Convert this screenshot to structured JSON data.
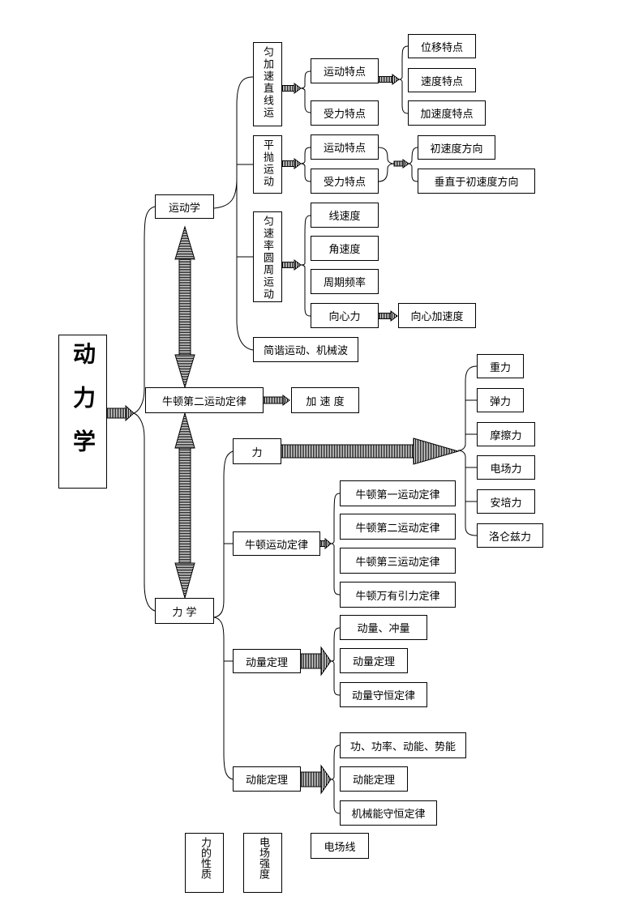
{
  "root": "动力学",
  "level1": {
    "kinematics": "运动学",
    "newton2": "牛顿第二运动定律",
    "acceleration": "加 速 度",
    "mechanics": "力 学"
  },
  "kinematics": {
    "uniform_accel": "匀加速直线运",
    "projectile": "平抛运动",
    "circular": "匀速率圆周运动",
    "shm": "简谐运动、机械波",
    "ua_items": [
      "运动特点",
      "受力特点"
    ],
    "ua_sub": [
      "位移特点",
      "速度特点",
      "加速度特点"
    ],
    "pr_items": [
      "运动特点",
      "受力特点"
    ],
    "pr_sub": [
      "初速度方向",
      "垂直于初速度方向"
    ],
    "circ_items": [
      "线速度",
      "角速度",
      "周期频率",
      "向心力"
    ],
    "centripetal_accel": "向心加速度"
  },
  "mechanics": {
    "force": "力",
    "forces": [
      "重力",
      "弹力",
      "摩擦力",
      "电场力",
      "安培力",
      "洛仑兹力"
    ],
    "newton_laws": "牛顿运动定律",
    "laws": [
      "牛顿第一运动定律",
      "牛顿第二运动定律",
      "牛顿第三运动定律",
      "牛顿万有引力定律"
    ],
    "momentum_theorem": "动量定理",
    "momentum_items": [
      "动量、冲量",
      "动量定理",
      "动量守恒定律"
    ],
    "energy_theorem": "动能定理",
    "energy_items": [
      "功、功率、动能、势能",
      "动能定理",
      "机械能守恒定律"
    ]
  },
  "footer": [
    "力的性质",
    "电场强度",
    "电场线"
  ]
}
